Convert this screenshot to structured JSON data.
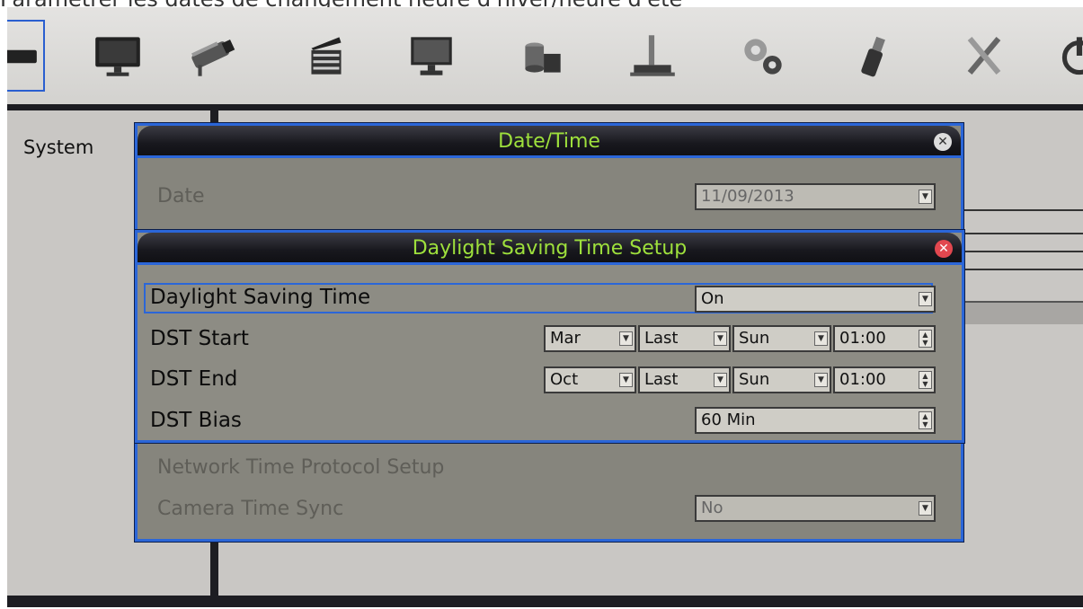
{
  "caption": "Paramétrer les dates de changement heure d'hiver/heure d'été",
  "toolbar": {
    "icons": [
      "dvr-icon",
      "monitor-icon",
      "camera-icon",
      "clapperboard-icon",
      "display-icon",
      "storage-icon",
      "network-icon",
      "gears-icon",
      "usb-icon",
      "tools-icon",
      "power-icon"
    ],
    "selected": "dvr-icon"
  },
  "sidebar": {
    "title": "System"
  },
  "datetime_dialog": {
    "title": "Date/Time",
    "date_label": "Date",
    "date_value": "11/09/2013",
    "ntp_label": "Network Time Protocol Setup",
    "camera_sync_label": "Camera Time Sync",
    "camera_sync_value": "No"
  },
  "dst_dialog": {
    "title": "Daylight Saving Time Setup",
    "dst_label": "Daylight Saving Time",
    "dst_value": "On",
    "start_label": "DST Start",
    "start": {
      "month": "Mar",
      "week": "Last",
      "day": "Sun",
      "time": "01:00"
    },
    "end_label": "DST End",
    "end": {
      "month": "Oct",
      "week": "Last",
      "day": "Sun",
      "time": "01:00"
    },
    "bias_label": "DST Bias",
    "bias_value": "60 Min"
  },
  "colors": {
    "title_text": "#9ee03c",
    "frame_blue": "#2b66d8",
    "close_red": "#e2474f"
  }
}
